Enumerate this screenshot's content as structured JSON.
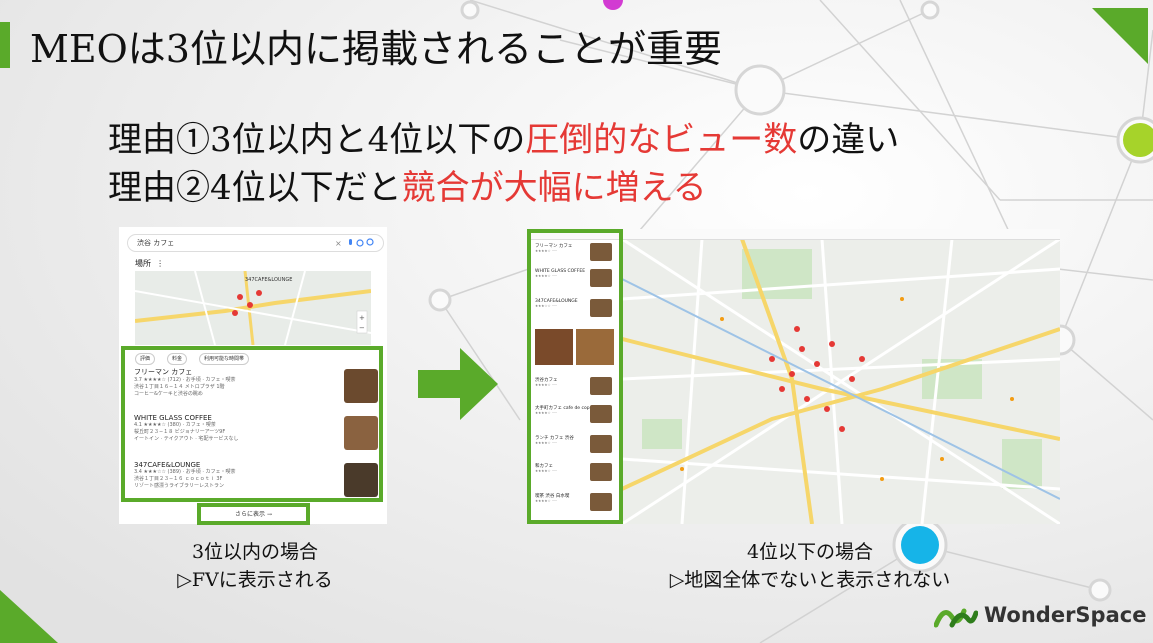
{
  "slide": {
    "title": "MEOは3位以内に掲載されることが重要",
    "reason1_prefix": "理由①3位以内と4位以下の",
    "reason1_highlight": "圧倒的なビュー数",
    "reason1_suffix": "の違い",
    "reason2_prefix": "理由②4位以下だと",
    "reason2_highlight": "競合が大幅に増える",
    "accent_color": "#5aaa2a",
    "highlight_color": "#e53935"
  },
  "left_caption": {
    "line1": "3位以内の場合",
    "line2": "▷FVに表示される"
  },
  "right_caption": {
    "line1": "4位以下の場合",
    "line2": "▷地図全体でないと表示されない"
  },
  "left_screenshot": {
    "query": "渋谷 カフェ",
    "places_label": "場所",
    "map_pin_label": "347CAFE&LOUNGE",
    "filters": [
      "評価",
      "料金",
      "利用可能な時間帯"
    ],
    "results": [
      {
        "name": "フリーマン カフェ",
        "line1": "3.7 ★★★★☆ (712) · お手頃 · カフェ・喫茶",
        "line2": "渋谷１丁目１６−１４ メトロプラザ 1階",
        "line3": "コーヒー&ケーキと渋谷の眺め"
      },
      {
        "name": "WHITE GLASS COFFEE",
        "line1": "4.1 ★★★★☆ (380) · カフェ・喫茶",
        "line2": "桜丘町２３−１８ ビジョナリーアーツ9F",
        "line3": "イートイン · テイクアウト · 宅配サービスなし"
      },
      {
        "name": "347CAFE&LOUNGE",
        "line1": "3.4 ★★★☆☆ (389) · お手頃 · カフェ・喫茶",
        "line2": "渋谷１丁目２３−１６ ｃｏｃｏｔｉ 3F",
        "line3": "リゾート感漂うライブラリーレストラン"
      }
    ],
    "more_button": "さらに表示 →"
  },
  "right_screenshot": {
    "sidebar_items": [
      {
        "name": "フリーマン カフェ"
      },
      {
        "name": "WHITE GLASS COFFEE"
      },
      {
        "name": "347CAFE&LOUNGE"
      },
      {
        "name": "渋谷カフェ"
      },
      {
        "name": "大手町カフェ cafe de copain"
      },
      {
        "name": "ランチ カフェ 渋谷"
      },
      {
        "name": "和カフェ"
      },
      {
        "name": "喫茶 渋谷 白水喫"
      }
    ]
  },
  "brand": {
    "name": "WonderSpace"
  }
}
